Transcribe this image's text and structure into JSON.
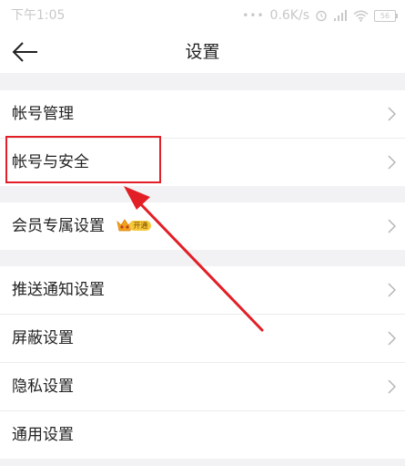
{
  "status_bar": {
    "time": "下午1:05",
    "network_speed": "0.6K/s",
    "battery_level": "56"
  },
  "nav": {
    "title": "设置",
    "back_icon": "arrow-left-icon"
  },
  "settings_groups": [
    {
      "items": [
        {
          "label": "帐号管理"
        },
        {
          "label": "帐号与安全"
        }
      ]
    },
    {
      "items": [
        {
          "label": "会员专属设置",
          "badge_text": "开通"
        }
      ]
    },
    {
      "items": [
        {
          "label": "推送通知设置"
        },
        {
          "label": "屏蔽设置"
        },
        {
          "label": "隐私设置"
        },
        {
          "label": "通用设置"
        }
      ]
    }
  ],
  "annotation": {
    "highlighted_item": "帐号与安全",
    "color": "#e21f26"
  },
  "colors": {
    "page_background": "#f2f2f4",
    "row_background": "#ffffff",
    "text": "#222222",
    "chevron": "#b5b5b5",
    "vip_badge": "#f7c83a"
  }
}
